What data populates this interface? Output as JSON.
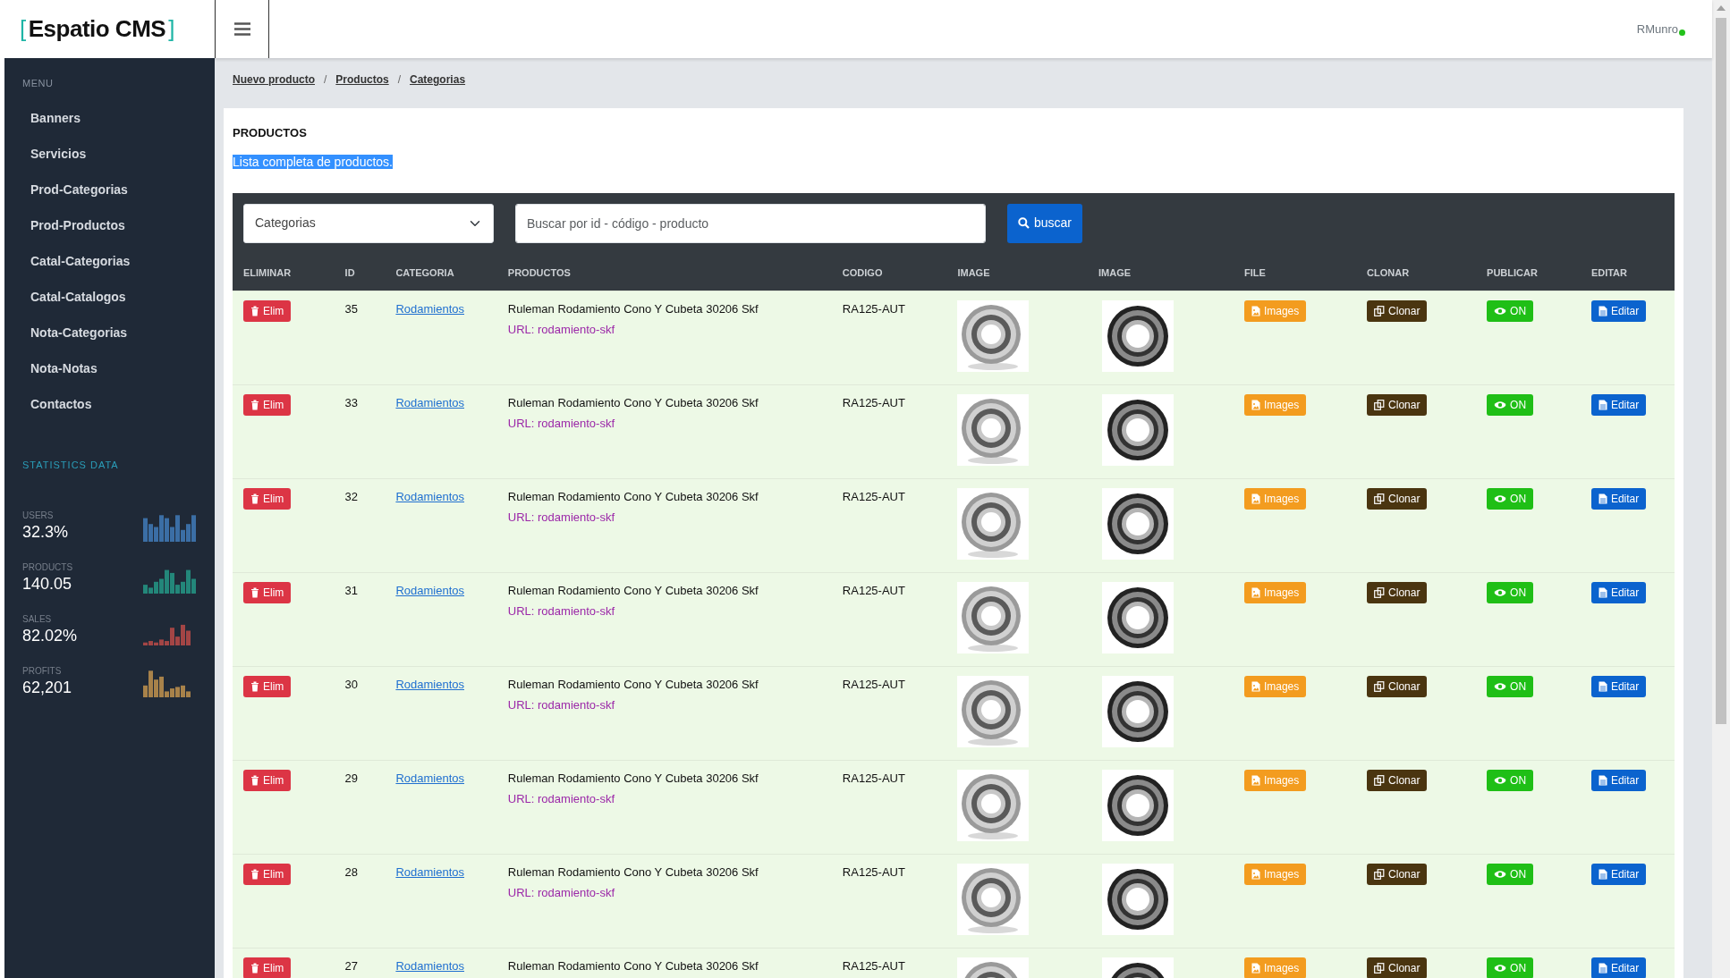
{
  "brand": {
    "open": "[",
    "name": "Espatio CMS",
    "close": "]"
  },
  "user": {
    "name": "RMunro",
    "online": true
  },
  "menu_label": "MENU",
  "menu": [
    "Banners",
    "Servicios",
    "Prod-Categorias",
    "Prod-Productos",
    "Catal-Categorias",
    "Catal-Catalogos",
    "Nota-Categorias",
    "Nota-Notas",
    "Contactos"
  ],
  "stats_label": "STATISTICS DATA",
  "stats": [
    {
      "label": "USERS",
      "value": "32.3%",
      "color": "#3b6ea5"
    },
    {
      "label": "PRODUCTS",
      "value": "140.05",
      "color": "#23877a"
    },
    {
      "label": "SALES",
      "value": "82.02%",
      "color": "#a34545"
    },
    {
      "label": "PROFITS",
      "value": "62,201",
      "color": "#a8824a"
    }
  ],
  "breadcrumb": [
    "Nuevo producto",
    "Productos",
    "Categorias"
  ],
  "breadcrumb_separator": "/",
  "panel": {
    "title": "PRODUCTOS",
    "subtitle": "Lista completa de productos.",
    "subtitle_selected": true
  },
  "filters": {
    "category": "Categorias",
    "search_placeholder": "Buscar por id - código - producto",
    "button": "buscar"
  },
  "columns": [
    "ELIMINAR",
    "ID",
    "CATEGORIA",
    "PRODUCTOS",
    "CODIGO",
    "IMAGE",
    "IMAGE",
    "FILE",
    "CLONAR",
    "PUBLICAR",
    "EDITAR"
  ],
  "rows": [
    {
      "delete": "Elim",
      "id": "35",
      "category": "Rodamientos",
      "product": "Ruleman Rodamiento Cono Y Cubeta 30206 Skf",
      "url": "URL: rodamiento-skf",
      "code": "RA125-AUT",
      "file": "Images",
      "clone": "Clonar",
      "publish": "ON",
      "published": true,
      "edit": "Editar"
    },
    {
      "delete": "Elim",
      "id": "33",
      "category": "Rodamientos",
      "product": "Ruleman Rodamiento Cono Y Cubeta 30206 Skf",
      "url": "URL: rodamiento-skf",
      "code": "RA125-AUT",
      "file": "Images",
      "clone": "Clonar",
      "publish": "ON",
      "published": true,
      "edit": "Editar"
    },
    {
      "delete": "Elim",
      "id": "32",
      "category": "Rodamientos",
      "product": "Ruleman Rodamiento Cono Y Cubeta 30206 Skf",
      "url": "URL: rodamiento-skf",
      "code": "RA125-AUT",
      "file": "Images",
      "clone": "Clonar",
      "publish": "ON",
      "published": true,
      "edit": "Editar"
    },
    {
      "delete": "Elim",
      "id": "31",
      "category": "Rodamientos",
      "product": "Ruleman Rodamiento Cono Y Cubeta 30206 Skf",
      "url": "URL: rodamiento-skf",
      "code": "RA125-AUT",
      "file": "Images",
      "clone": "Clonar",
      "publish": "ON",
      "published": true,
      "edit": "Editar"
    },
    {
      "delete": "Elim",
      "id": "30",
      "category": "Rodamientos",
      "product": "Ruleman Rodamiento Cono Y Cubeta 30206 Skf",
      "url": "URL: rodamiento-skf",
      "code": "RA125-AUT",
      "file": "Images",
      "clone": "Clonar",
      "publish": "ON",
      "published": true,
      "edit": "Editar"
    },
    {
      "delete": "Elim",
      "id": "29",
      "category": "Rodamientos",
      "product": "Ruleman Rodamiento Cono Y Cubeta 30206 Skf",
      "url": "URL: rodamiento-skf",
      "code": "RA125-AUT",
      "file": "Images",
      "clone": "Clonar",
      "publish": "ON",
      "published": true,
      "edit": "Editar"
    },
    {
      "delete": "Elim",
      "id": "28",
      "category": "Rodamientos",
      "product": "Ruleman Rodamiento Cono Y Cubeta 30206 Skf",
      "url": "URL: rodamiento-skf",
      "code": "RA125-AUT",
      "file": "Images",
      "clone": "Clonar",
      "publish": "ON",
      "published": true,
      "edit": "Editar"
    },
    {
      "delete": "Elim",
      "id": "27",
      "category": "Rodamientos",
      "product": "Ruleman Rodamiento Cono Y Cubeta 30206 Skf",
      "code": "RA125-AUT",
      "file": "Images",
      "clone": "Clonar",
      "publish": "ON",
      "published": true,
      "edit": "Editar"
    }
  ]
}
